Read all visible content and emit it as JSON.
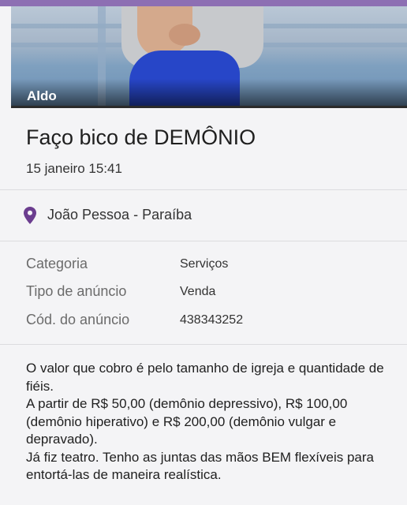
{
  "colors": {
    "accent": "#8d6fb3",
    "location_pin": "#6b3d8f"
  },
  "listing": {
    "owner_name": "Aldo",
    "title": "Faço bico de DEMÔNIO",
    "date": "15 janeiro 15:41",
    "location": "João Pessoa - Paraíba",
    "location_icon": "map-pin-icon",
    "details": [
      {
        "label": "Categoria",
        "value": "Serviços"
      },
      {
        "label": "Tipo de anúncio",
        "value": "Venda"
      },
      {
        "label": "Cód. do anúncio",
        "value": "438343252"
      }
    ],
    "description": [
      "O valor que cobro é pelo tamanho de igreja e quantidade de fiéis.",
      "A partir de R$ 50,00 (demônio depressivo), R$ 100,00 (demônio hiperativo) e R$ 200,00 (demônio vulgar e depravado).",
      "Já fiz teatro. Tenho as juntas das mãos BEM flexíveis para entortá-las de maneira realística."
    ]
  }
}
